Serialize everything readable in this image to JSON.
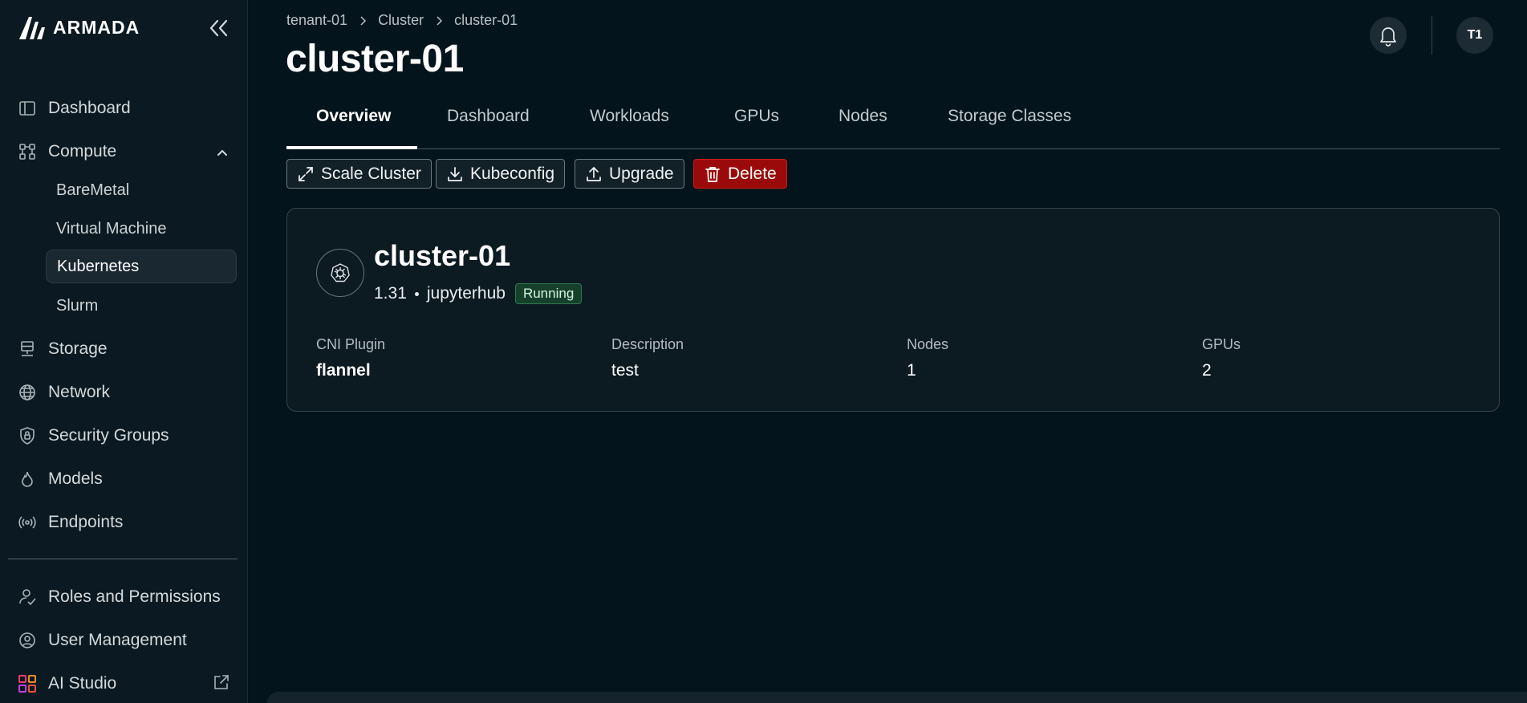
{
  "brand": {
    "name": "ARMADA"
  },
  "sidebar": {
    "items": [
      {
        "label": "Dashboard",
        "icon": "dashboard-icon"
      },
      {
        "label": "Compute",
        "icon": "compute-icon",
        "expanded": true,
        "children": [
          {
            "label": "BareMetal"
          },
          {
            "label": "Virtual Machine"
          },
          {
            "label": "Kubernetes",
            "active": true
          },
          {
            "label": "Slurm"
          }
        ]
      },
      {
        "label": "Storage",
        "icon": "storage-icon"
      },
      {
        "label": "Network",
        "icon": "network-icon"
      },
      {
        "label": "Security Groups",
        "icon": "security-groups-icon"
      },
      {
        "label": "Models",
        "icon": "models-icon"
      },
      {
        "label": "Endpoints",
        "icon": "endpoints-icon"
      }
    ],
    "bottom_items": [
      {
        "label": "Roles and Permissions",
        "icon": "roles-icon"
      },
      {
        "label": "User Management",
        "icon": "user-management-icon"
      },
      {
        "label": "AI Studio",
        "icon": "ai-studio-icon",
        "external": true
      }
    ]
  },
  "breadcrumb": [
    "tenant-01",
    "Cluster",
    "cluster-01"
  ],
  "page": {
    "title": "cluster-01"
  },
  "header": {
    "avatar_initials": "T1"
  },
  "tabs": [
    {
      "label": "Overview",
      "active": true
    },
    {
      "label": "Dashboard"
    },
    {
      "label": "Workloads"
    },
    {
      "label": "GPUs"
    },
    {
      "label": "Nodes"
    },
    {
      "label": "Storage Classes"
    }
  ],
  "actions": {
    "scale": "Scale Cluster",
    "kubeconfig": "Kubeconfig",
    "upgrade": "Upgrade",
    "delete": "Delete"
  },
  "cluster": {
    "name": "cluster-01",
    "version": "1.31",
    "template": "jupyterhub",
    "status": "Running",
    "fields": [
      {
        "label": "CNI Plugin",
        "value": "flannel"
      },
      {
        "label": "Description",
        "value": "test"
      },
      {
        "label": "Nodes",
        "value": "1"
      },
      {
        "label": "GPUs",
        "value": "2"
      }
    ]
  },
  "colors": {
    "background": "#03141c",
    "sidebar": "#0b1a22",
    "danger": "#9b0a0a",
    "status_running": "#16402b"
  }
}
